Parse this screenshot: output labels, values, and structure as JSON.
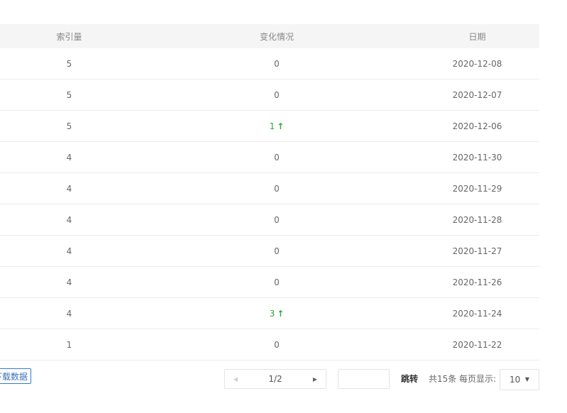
{
  "table": {
    "headers": {
      "index": "索引量",
      "change": "变化情况",
      "date": "日期"
    },
    "rows": [
      {
        "index": "5",
        "change": "0",
        "change_up": false,
        "date": "2020-12-08"
      },
      {
        "index": "5",
        "change": "0",
        "change_up": false,
        "date": "2020-12-07"
      },
      {
        "index": "5",
        "change": "1",
        "change_up": true,
        "date": "2020-12-06"
      },
      {
        "index": "4",
        "change": "0",
        "change_up": false,
        "date": "2020-11-30"
      },
      {
        "index": "4",
        "change": "0",
        "change_up": false,
        "date": "2020-11-29"
      },
      {
        "index": "4",
        "change": "0",
        "change_up": false,
        "date": "2020-11-28"
      },
      {
        "index": "4",
        "change": "0",
        "change_up": false,
        "date": "2020-11-27"
      },
      {
        "index": "4",
        "change": "0",
        "change_up": false,
        "date": "2020-11-26"
      },
      {
        "index": "4",
        "change": "3",
        "change_up": true,
        "date": "2020-11-24"
      },
      {
        "index": "1",
        "change": "0",
        "change_up": false,
        "date": "2020-11-22"
      }
    ]
  },
  "toolbar": {
    "download_label": "下载数据"
  },
  "pagination": {
    "page_indicator": "1/2",
    "prev_icon": "caret-left-icon",
    "next_icon": "caret-right-icon",
    "jump_input_value": "",
    "jump_label": "跳转",
    "total_text": "共15条",
    "per_page_label": "每页显示:",
    "per_page_value": "10"
  },
  "colors": {
    "up_arrow": "#2ea836",
    "header_bg": "#f5f5f5",
    "download_border": "#3a78c8"
  }
}
